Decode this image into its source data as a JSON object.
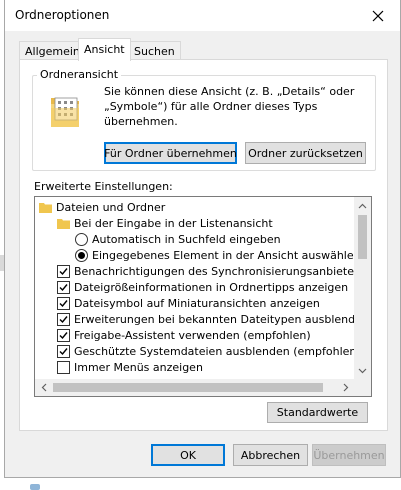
{
  "window": {
    "title": "Ordneroptionen"
  },
  "tabs": [
    {
      "label": "Allgemein"
    },
    {
      "label": "Ansicht"
    },
    {
      "label": "Suchen"
    }
  ],
  "folder_view": {
    "legend": "Ordneransicht",
    "description": "Sie können diese Ansicht (z. B. „Details“ oder „Symbole“) für alle Ordner dieses Typs übernehmen.",
    "apply_button": "Für Ordner übernehmen",
    "reset_button": "Ordner zurücksetzen"
  },
  "advanced": {
    "label": "Erweiterte Einstellungen:",
    "items": [
      {
        "type": "folder",
        "label": "Dateien und Ordner"
      },
      {
        "type": "folder",
        "label": "Bei der Eingabe in der Listenansicht"
      },
      {
        "type": "radio",
        "checked": false,
        "label": "Automatisch in Suchfeld eingeben"
      },
      {
        "type": "radio",
        "checked": true,
        "label": "Eingegebenes Element in der Ansicht auswählen"
      },
      {
        "type": "checkbox",
        "checked": true,
        "label": "Benachrichtigungen des Synchronisierungsanbieters anzeig"
      },
      {
        "type": "checkbox",
        "checked": true,
        "label": "Dateigrößeinformationen in Ordnertipps anzeigen"
      },
      {
        "type": "checkbox",
        "checked": true,
        "label": "Dateisymbol auf Miniaturansichten anzeigen"
      },
      {
        "type": "checkbox",
        "checked": true,
        "label": "Erweiterungen bei bekannten Dateitypen ausblenden"
      },
      {
        "type": "checkbox",
        "checked": true,
        "label": "Freigabe-Assistent verwenden (empfohlen)"
      },
      {
        "type": "checkbox",
        "checked": true,
        "label": "Geschützte Systemdateien ausblenden (empfohlen)"
      },
      {
        "type": "checkbox",
        "checked": false,
        "label": "Immer Menüs anzeigen"
      }
    ]
  },
  "defaults_button": "Standardwerte",
  "footer": {
    "ok": "OK",
    "cancel": "Abbrechen",
    "apply": "Übernehmen"
  },
  "colors": {
    "folder": "#f0c64e",
    "accent": "#0078d7"
  },
  "icons": {
    "close": "close-icon",
    "folder": "folder-icon"
  }
}
